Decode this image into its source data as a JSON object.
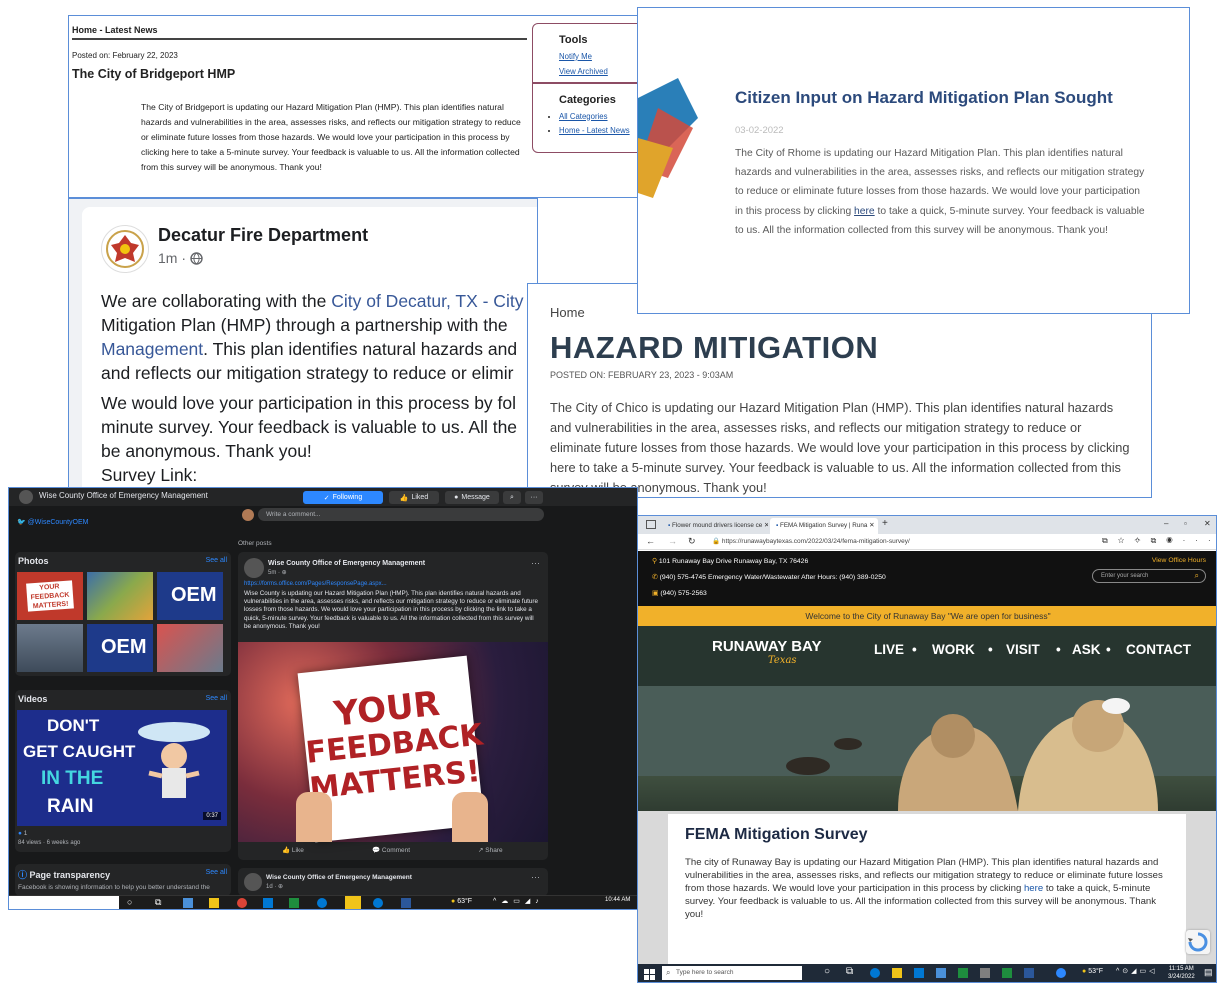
{
  "bridgeport": {
    "breadcrumb": "Home - Latest News",
    "posted": "Posted on: February 22, 2023",
    "title": "The City of Bridgeport HMP",
    "body": "The City of Bridgeport is updating our Hazard Mitigation Plan (HMP). This plan identifies natural hazards and vulnerabilities in the area, assesses risks, and reflects our mitigation strategy to reduce or eliminate future losses from those hazards. We would love your participation in this process by clicking here to take a 5-minute survey. Your feedback is valuable to us. All the information collected from this survey will be anonymous. Thank you!",
    "tools_heading": "Tools",
    "tools_links": [
      "Notify Me",
      "View Archived"
    ],
    "categories_heading": "Categories",
    "categories": [
      "All Categories",
      "Home - Latest News"
    ]
  },
  "decatur": {
    "name": "Decatur Fire Department",
    "meta": "1m · ",
    "p1_a": "We are collaborating with the ",
    "p1_link1": "City of Decatur, TX - City",
    "p1_b": "Mitigation Plan (HMP) through a partnership with the",
    "p1_link2": "Management",
    "p1_c": ". This plan identifies natural hazards and",
    "p1_d": "and reflects our mitigation strategy to reduce or elimir",
    "p2_a": "We would love your participation in this process by fol",
    "p2_b": "minute survey. Your feedback is valuable to us. All the",
    "p2_c": "be anonymous. Thank you!",
    "survey": "Survey Link:"
  },
  "rhome": {
    "title": "Citizen Input on Hazard Mitigation Plan Sought",
    "date": "03-02-2022",
    "body_a": "The City of Rhome is updating our Hazard Mitigation Plan. This plan identifies natural hazards and vulnerabilities in the area, assesses risks, and reflects our mitigation strategy to reduce or eliminate future losses from those hazards. We would love your participation in this process by clicking ",
    "body_link": "here",
    "body_b": " to take a quick, 5-minute survey. Your feedback is valuable to us. All the information collected from this survey will be anonymous. Thank you!"
  },
  "chico": {
    "home": "Home",
    "title": "HAZARD MITIGATION",
    "posted": "POSTED ON: FEBRUARY 23, 2023 - 9:03AM",
    "body": "The City of Chico is updating our Hazard Mitigation Plan (HMP). This plan identifies natural hazards and vulnerabilities in the area, assesses risks, and reflects our mitigation strategy to reduce or eliminate future losses from those hazards. We would love your participation in this process by clicking here to take a 5-minute survey. Your feedback is valuable to us. All the information collected from this survey will be anonymous. Thank you!"
  },
  "wise": {
    "page_name": "Wise County Office of Emergency Management",
    "following": "Following",
    "liked": "Liked",
    "message": "Message",
    "twitter": "@WiseCountyOEM",
    "photos": "Photos",
    "see_all": "See all",
    "videos": "Videos",
    "video_title_1": "DON'T",
    "video_title_2": "GET CAUGHT",
    "video_title_3": "IN THE",
    "video_title_4": "RAIN",
    "video_duration": "0:37",
    "video_reactions": "1",
    "video_meta": "84 views · 6 weeks ago",
    "transparency": "Page transparency",
    "transparency_text": "Facebook is showing information to help you better understand the",
    "comment_placeholder": "Write a comment...",
    "other_posts": "Other posts",
    "post_author": "Wise County Office of Emergency Management",
    "post_time": "5m · ",
    "post_link": "https://forms.office.com/Pages/ResponsePage.aspx...",
    "post_body": "Wise County is updating our Hazard Mitigation Plan (HMP). This plan identifies natural hazards and vulnerabilities in the area, assesses risks, and reflects our mitigation strategy to reduce or eliminate future losses from those hazards. We would love your participation in this process by clicking the link to take a quick, 5-minute survey. Your feedback is valuable to us. All the information collected from this survey will be anonymous. Thank you!",
    "image_text_1": "YOUR",
    "image_text_2": "FEEDBACK",
    "image_text_3": "MATTERS!",
    "like": "Like",
    "comment": "Comment",
    "share": "Share",
    "post2_author": "Wise County Office of Emergency Management",
    "post2_time": "1d · ",
    "weather": "63°F",
    "time": "10:44 AM",
    "oem": "OEM"
  },
  "runaway": {
    "tab1": "Flower mound drivers license ce",
    "tab2": "FEMA Mitigation Survey | Runa",
    "url": "https://runawaybaytexas.com/2022/03/24/fema-mitigation-survey/",
    "address": "101 Runaway Bay Drive Runaway Bay, TX 76426",
    "phone1": "(940) 575-4745 Emergency Water/Wastewater After Hours: (940) 389-0250",
    "phone2": "(940) 575-2563",
    "office_hours": "View Office Hours",
    "search_placeholder": "Enter your search",
    "welcome": "Welcome to the City of Runaway Bay \"We are open for business\"",
    "logo": "RUNAWAY BAY",
    "logo_script": "Texas",
    "nav": [
      "LIVE",
      "WORK",
      "VISIT",
      "ASK",
      "CONTACT"
    ],
    "title": "FEMA Mitigation Survey",
    "body_a": "The city of Runaway Bay is updating our Hazard Mitigation Plan (HMP). This plan identifies natural hazards and vulnerabilities in the area, assesses risks, and reflects our mitigation strategy to reduce or eliminate future losses from those hazards. We would love your participation in this process by clicking ",
    "body_link": "here",
    "body_b": " to take a quick, 5-minute survey. Your feedback is valuable to us. All the information collected from this survey will be anonymous. Thank you!",
    "taskbar_search": "Type here to search",
    "weather": "53°F",
    "time": "11:15 AM",
    "date": "3/24/2022"
  },
  "colors": {
    "link": "#1a56a8",
    "facebook_blue": "#2d88ff",
    "runaway_yellow": "#f1b12a",
    "border": "#5b8ed8"
  }
}
